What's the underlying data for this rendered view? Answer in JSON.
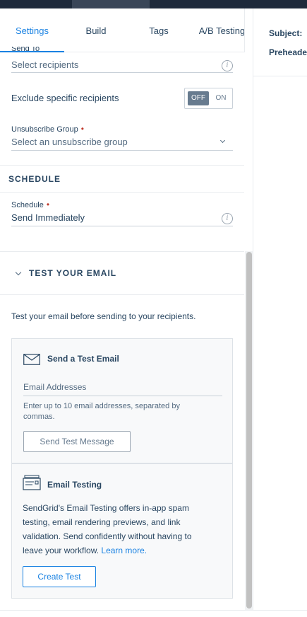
{
  "tabs": [
    {
      "label": "Settings",
      "active": true
    },
    {
      "label": "Build",
      "active": false
    },
    {
      "label": "Tags",
      "active": false
    },
    {
      "label": "A/B Testing",
      "active": false
    }
  ],
  "right_header": {
    "subject_label": "Subject:",
    "preheader_label": "Preheade"
  },
  "settings": {
    "send_to": {
      "label": "Send To",
      "placeholder": "Select recipients"
    },
    "exclude": {
      "label": "Exclude specific recipients",
      "off_label": "OFF",
      "on_label": "ON",
      "state": "off"
    },
    "unsubscribe": {
      "label": "Unsubscribe Group",
      "required_mark": "•",
      "placeholder": "Select an unsubscribe group"
    }
  },
  "schedule_section": {
    "title": "SCHEDULE",
    "field_label": "Schedule",
    "required_mark": "•",
    "value": "Send Immediately"
  },
  "test_section": {
    "title": "TEST YOUR EMAIL",
    "intro": "Test your email before sending to your recipients.",
    "send_test": {
      "title": "Send a Test Email",
      "input_placeholder": "Email Addresses",
      "help_line1": "Enter up to 10 email addresses, separated by",
      "help_line2": "commas.",
      "button": "Send Test Message"
    },
    "email_testing": {
      "title": "Email Testing",
      "line1": "SendGrid's Email Testing offers in-app spam",
      "line2": "testing, email rendering previews, and link",
      "line3": "validation. Send confidently without having to",
      "line4_text": "leave your workflow.",
      "link": "Learn more.",
      "button": "Create Test"
    }
  },
  "colors": {
    "accent": "#1a82e2",
    "text": "#294661",
    "required": "#c0392b",
    "topbar": "#1e2a3b"
  }
}
